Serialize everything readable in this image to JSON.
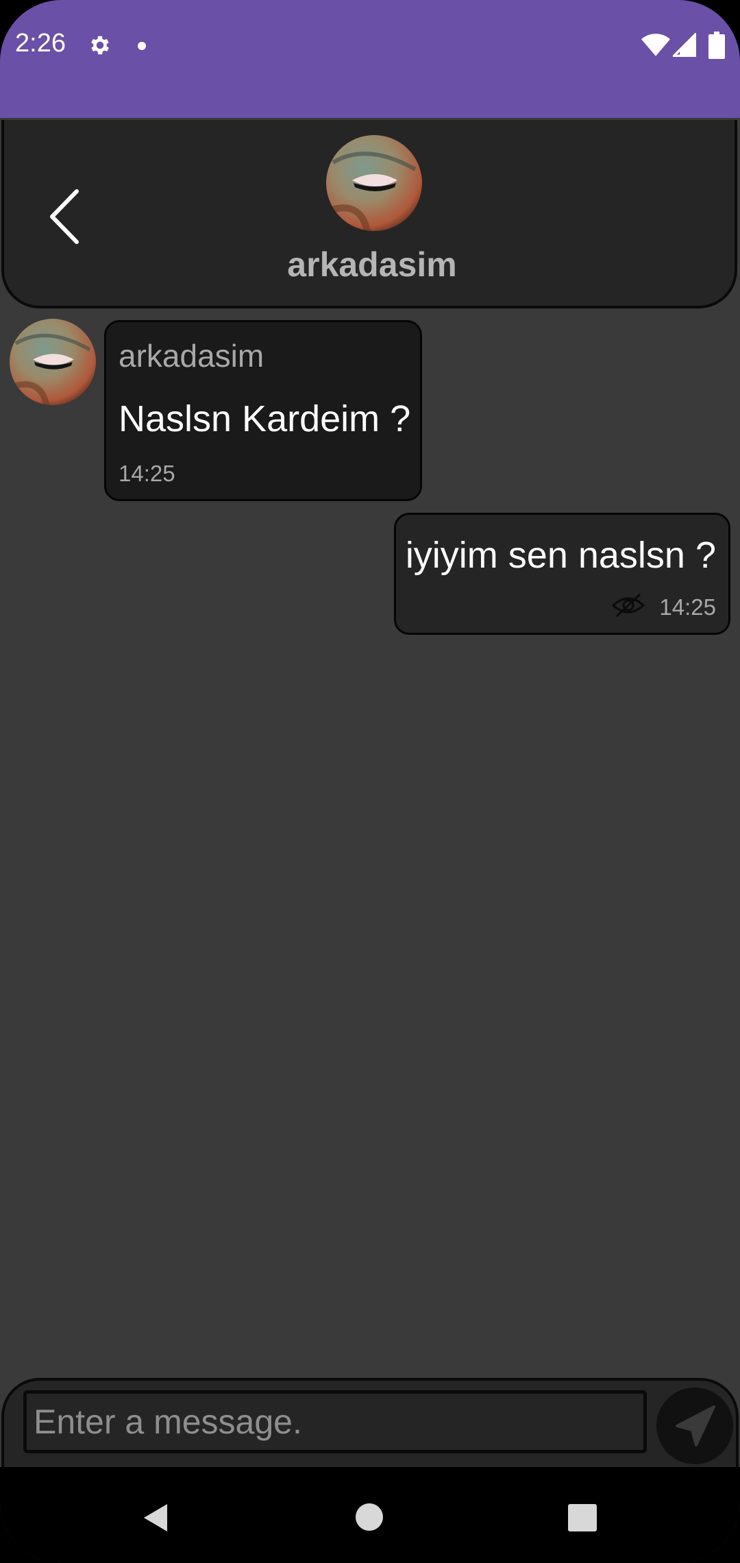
{
  "status_bar": {
    "time": "2:26",
    "icons": [
      "gear-icon",
      "dot-icon",
      "wifi-icon",
      "signal-icon",
      "battery-icon"
    ],
    "background": "#6a50a7"
  },
  "header": {
    "back_icon": "chevron-left-icon",
    "contact_name": "arkadasim",
    "avatar": "contact-avatar"
  },
  "messages": [
    {
      "direction": "incoming",
      "sender": "arkadasim",
      "text": "Naslsn Kardeim ?",
      "time": "14:25"
    },
    {
      "direction": "outgoing",
      "text": "iyiyim sen naslsn ?",
      "status_icon": "eye-off-icon",
      "time": "14:25"
    }
  ],
  "composer": {
    "placeholder": "Enter a message.",
    "value": "",
    "send_icon": "send-icon"
  },
  "nav_bar": {
    "buttons": [
      "nav-back-icon",
      "nav-home-icon",
      "nav-recents-icon"
    ]
  },
  "colors": {
    "chat_background": "#3a3a3a",
    "header_background": "#252525",
    "incoming_bubble": "#1a1a1a",
    "outgoing_bubble": "#252525"
  }
}
